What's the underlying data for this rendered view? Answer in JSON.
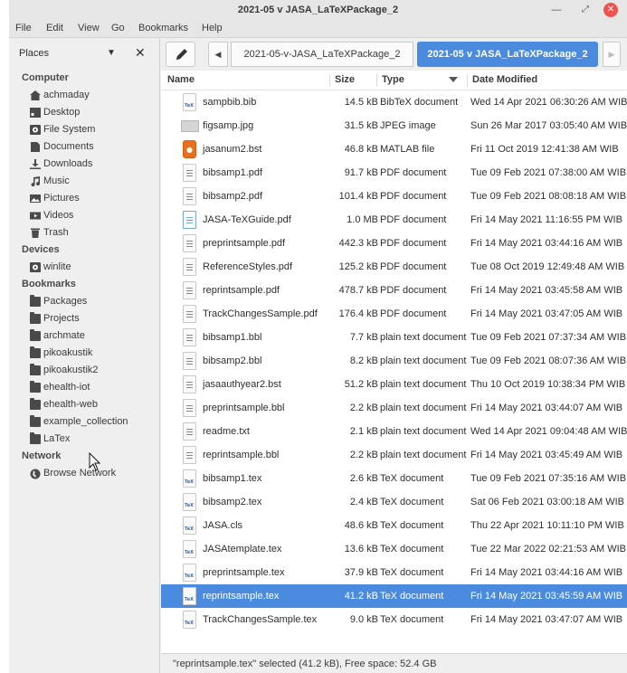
{
  "window": {
    "title": "2021-05 v JASA_LaTeXPackage_2"
  },
  "menu": [
    "File",
    "Edit",
    "View",
    "Go",
    "Bookmarks",
    "Help"
  ],
  "sidebar": {
    "header": "Places",
    "sections": [
      {
        "title": "Computer",
        "items": [
          {
            "label": "achmaday",
            "icon": "home-icon"
          },
          {
            "label": "Desktop",
            "icon": "desktop-icon"
          },
          {
            "label": "File System",
            "icon": "drive-icon"
          },
          {
            "label": "Documents",
            "icon": "documents-icon"
          },
          {
            "label": "Downloads",
            "icon": "download-icon"
          },
          {
            "label": "Music",
            "icon": "music-icon"
          },
          {
            "label": "Pictures",
            "icon": "pictures-icon"
          },
          {
            "label": "Videos",
            "icon": "videos-icon"
          },
          {
            "label": "Trash",
            "icon": "trash-icon"
          }
        ]
      },
      {
        "title": "Devices",
        "items": [
          {
            "label": "winlite",
            "icon": "drive-icon"
          }
        ]
      },
      {
        "title": "Bookmarks",
        "items": [
          {
            "label": "Packages",
            "icon": "folder-icon"
          },
          {
            "label": "Projects",
            "icon": "folder-icon"
          },
          {
            "label": "archmate",
            "icon": "folder-icon"
          },
          {
            "label": "pikoakustik",
            "icon": "folder-icon"
          },
          {
            "label": "pikoakustik2",
            "icon": "folder-icon"
          },
          {
            "label": "ehealth-iot",
            "icon": "folder-icon"
          },
          {
            "label": "ehealth-web",
            "icon": "folder-icon"
          },
          {
            "label": "example_collection",
            "icon": "folder-icon"
          },
          {
            "label": "LaTex",
            "icon": "folder-icon"
          }
        ]
      },
      {
        "title": "Network",
        "items": [
          {
            "label": "Browse Network",
            "icon": "network-icon"
          }
        ]
      }
    ]
  },
  "toolbar": {
    "crumbs": [
      "2021-05-v-JASA_LaTeXPackage_2",
      "2021-05 v JASA_LaTeXPackage_2"
    ]
  },
  "columns": {
    "name": "Name",
    "size": "Size",
    "type": "Type",
    "date": "Date Modified"
  },
  "files": [
    {
      "name": "sampbib.bib",
      "size": "14.5 kB",
      "type": "BibTeX document",
      "date": "Wed 14 Apr 2021 06:30:26 AM WIB",
      "icon": "tex"
    },
    {
      "name": "figsamp.jpg",
      "size": "31.5 kB",
      "type": "JPEG image",
      "date": "Sun 26 Mar 2017 03:05:40 AM WIB",
      "icon": "jpg"
    },
    {
      "name": "jasanum2.bst",
      "size": "46.8 kB",
      "type": "MATLAB file",
      "date": "Fri 11 Oct 2019 12:41:38 AM WIB",
      "icon": "bst"
    },
    {
      "name": "bibsamp1.pdf",
      "size": "91.7 kB",
      "type": "PDF document",
      "date": "Tue 09 Feb 2021 07:38:00 AM WIB",
      "icon": "pdf"
    },
    {
      "name": "bibsamp2.pdf",
      "size": "101.4 kB",
      "type": "PDF document",
      "date": "Tue 09 Feb 2021 08:08:18 AM WIB",
      "icon": "pdf"
    },
    {
      "name": "JASA-TeXGuide.pdf",
      "size": "1.0 MB",
      "type": "PDF document",
      "date": "Fri 14 May 2021 11:16:55 PM WIB",
      "icon": "pdfblue"
    },
    {
      "name": "preprintsample.pdf",
      "size": "442.3 kB",
      "type": "PDF document",
      "date": "Fri 14 May 2021 03:44:16 AM WIB",
      "icon": "pdf"
    },
    {
      "name": "ReferenceStyles.pdf",
      "size": "125.2 kB",
      "type": "PDF document",
      "date": "Tue 08 Oct 2019 12:49:48 AM WIB",
      "icon": "pdf"
    },
    {
      "name": "reprintsample.pdf",
      "size": "478.7 kB",
      "type": "PDF document",
      "date": "Fri 14 May 2021 03:45:58 AM WIB",
      "icon": "pdf"
    },
    {
      "name": "TrackChangesSample.pdf",
      "size": "176.4 kB",
      "type": "PDF document",
      "date": "Fri 14 May 2021 03:47:05 AM WIB",
      "icon": "pdf"
    },
    {
      "name": "bibsamp1.bbl",
      "size": "7.7 kB",
      "type": "plain text document",
      "date": "Tue 09 Feb 2021 07:37:34 AM WIB",
      "icon": "txt"
    },
    {
      "name": "bibsamp2.bbl",
      "size": "8.2 kB",
      "type": "plain text document",
      "date": "Tue 09 Feb 2021 08:07:36 AM WIB",
      "icon": "txt"
    },
    {
      "name": "jasaauthyear2.bst",
      "size": "51.2 kB",
      "type": "plain text document",
      "date": "Thu 10 Oct 2019 10:38:34 PM WIB",
      "icon": "txt"
    },
    {
      "name": "preprintsample.bbl",
      "size": "2.2 kB",
      "type": "plain text document",
      "date": "Fri 14 May 2021 03:44:07 AM WIB",
      "icon": "txt"
    },
    {
      "name": "readme.txt",
      "size": "2.1 kB",
      "type": "plain text document",
      "date": "Wed 14 Apr 2021 09:04:48 AM WIB",
      "icon": "txt"
    },
    {
      "name": "reprintsample.bbl",
      "size": "2.2 kB",
      "type": "plain text document",
      "date": "Fri 14 May 2021 03:45:49 AM WIB",
      "icon": "txt"
    },
    {
      "name": "bibsamp1.tex",
      "size": "2.6 kB",
      "type": "TeX document",
      "date": "Tue 09 Feb 2021 07:35:16 AM WIB",
      "icon": "tex"
    },
    {
      "name": "bibsamp2.tex",
      "size": "2.4 kB",
      "type": "TeX document",
      "date": "Sat 06 Feb 2021 03:00:18 AM WIB",
      "icon": "tex"
    },
    {
      "name": "JASA.cls",
      "size": "48.6 kB",
      "type": "TeX document",
      "date": "Thu 22 Apr 2021 10:11:10 PM WIB",
      "icon": "tex"
    },
    {
      "name": "JASAtemplate.tex",
      "size": "13.6 kB",
      "type": "TeX document",
      "date": "Tue 22 Mar 2022 02:21:53 AM WIB",
      "icon": "tex"
    },
    {
      "name": "preprintsample.tex",
      "size": "37.9 kB",
      "type": "TeX document",
      "date": "Fri 14 May 2021 03:44:16 AM WIB",
      "icon": "tex"
    },
    {
      "name": "reprintsample.tex",
      "size": "41.2 kB",
      "type": "TeX document",
      "date": "Fri 14 May 2021 03:45:59 AM WIB",
      "icon": "tex",
      "selected": true
    },
    {
      "name": "TrackChangesSample.tex",
      "size": "9.0 kB",
      "type": "TeX document",
      "date": "Fri 14 May 2021 03:47:07 AM WIB",
      "icon": "tex"
    }
  ],
  "status": "\"reprintsample.tex\" selected (41.2 kB), Free space: 52.4 GB",
  "colors": {
    "accent": "#4a8be0",
    "close": "#ef5350",
    "bst_icon": "#e8701f"
  }
}
